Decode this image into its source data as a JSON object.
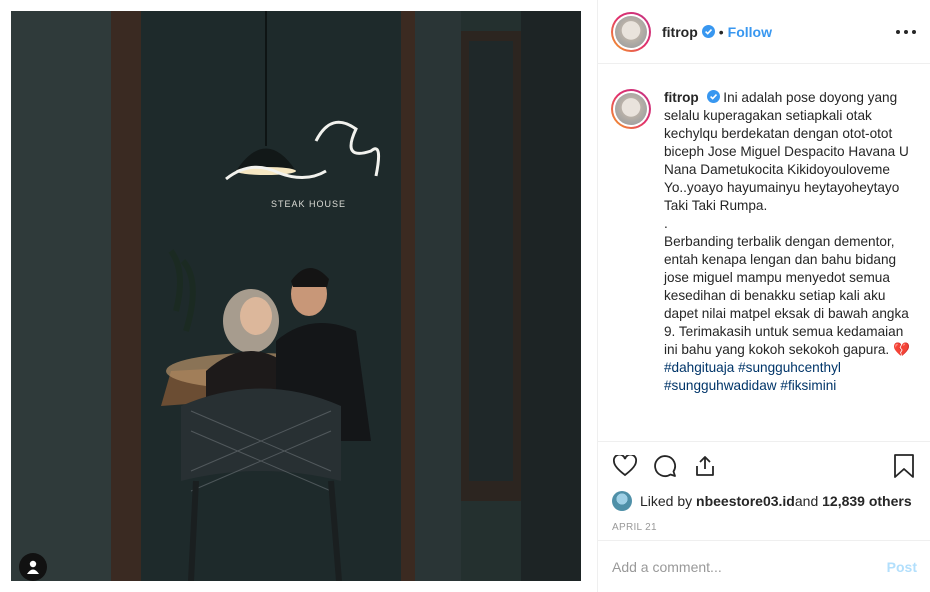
{
  "header": {
    "username": "fitrop",
    "separator": "•",
    "follow_label": "Follow"
  },
  "caption": {
    "username": "fitrop",
    "text": "Ini adalah pose doyong yang selalu kuperagakan setiapkali otak kechylqu berdekatan dengan otot-otot biceph Jose Miguel Despacito Havana U Nana Dametukocita Kikidoyouloveme Yo..yoayo hayumainyu heytayoheytayo Taki Taki Rumpa.\n.\nBerbanding terbalik dengan dementor, entah kenapa lengan dan bahu bidang jose miguel mampu menyedot semua kesedihan di benakku setiap kali aku dapet nilai matpel eksak di bawah angka 9. Terimakasih untuk semua kedamaian ini bahu yang kokoh sekokoh gapura. ",
    "emoji": "💔",
    "hashtags": [
      "#dahgituaja",
      "#sungguhcenthyl",
      "#sungguhwadidaw",
      "#fiksimini"
    ]
  },
  "likes": {
    "prefix": "Liked by ",
    "user": "nbeestore03.id",
    "middle": " and ",
    "others": "12,839 others"
  },
  "date": "APRIL 21",
  "comment": {
    "placeholder": "Add a comment...",
    "post_label": "Post"
  },
  "photo": {
    "sign_text": "STEAK HOUSE"
  },
  "colors": {
    "link": "#3897f0",
    "hashtag": "#003569",
    "post_disabled": "#b2dffc",
    "like_heart": "#e0354a"
  }
}
